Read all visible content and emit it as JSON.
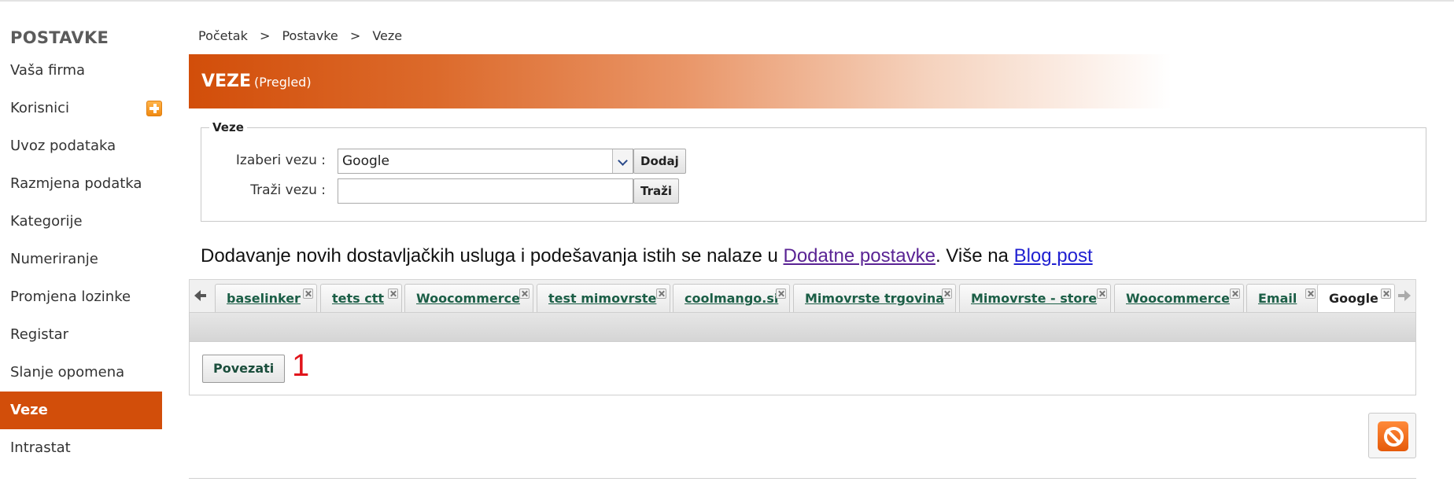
{
  "sidebar": {
    "title": "POSTAVKE",
    "items": [
      {
        "label": "Vaša firma"
      },
      {
        "label": "Korisnici"
      },
      {
        "label": "Uvoz podataka"
      },
      {
        "label": "Razmjena podatka"
      },
      {
        "label": "Kategorije"
      },
      {
        "label": "Numeriranje"
      },
      {
        "label": "Promjena lozinke"
      },
      {
        "label": "Registar"
      },
      {
        "label": "Slanje opomena"
      },
      {
        "label": "Veze",
        "active": true
      },
      {
        "label": "Intrastat"
      }
    ]
  },
  "breadcrumb": [
    "Početak",
    ">",
    "Postavke",
    ">",
    "Veze"
  ],
  "header": {
    "title": "VEZE",
    "subtitle": "(Pregled)"
  },
  "form": {
    "legend": "Veze",
    "select_label": "Izaberi vezu :",
    "select_value": "Google",
    "add_button": "Dodaj",
    "search_label": "Traži vezu :",
    "search_value": "",
    "search_button": "Traži"
  },
  "info": {
    "text_before": "Dodavanje novih dostavljačkih usluga i podešavanja istih se nalaze u ",
    "link1": "Dodatne postavke",
    "text_middle": ". Više na ",
    "link2": "Blog post"
  },
  "tabs": [
    {
      "label": "baselinker"
    },
    {
      "label": "tets ctt"
    },
    {
      "label": "Woocommerce"
    },
    {
      "label": "test mimovrste"
    },
    {
      "label": "coolmango.si"
    },
    {
      "label": "Mimovrste trgovina"
    },
    {
      "label": "Mimovrste - store"
    },
    {
      "label": "Woocommerce"
    },
    {
      "label": "Email"
    },
    {
      "label": "Google",
      "active": true
    }
  ],
  "content": {
    "connect_button": "Povezati",
    "count": "1"
  },
  "colors": {
    "accent": "#d24e0a",
    "tab_text": "#1b5e46",
    "count_red": "#e1141b"
  }
}
